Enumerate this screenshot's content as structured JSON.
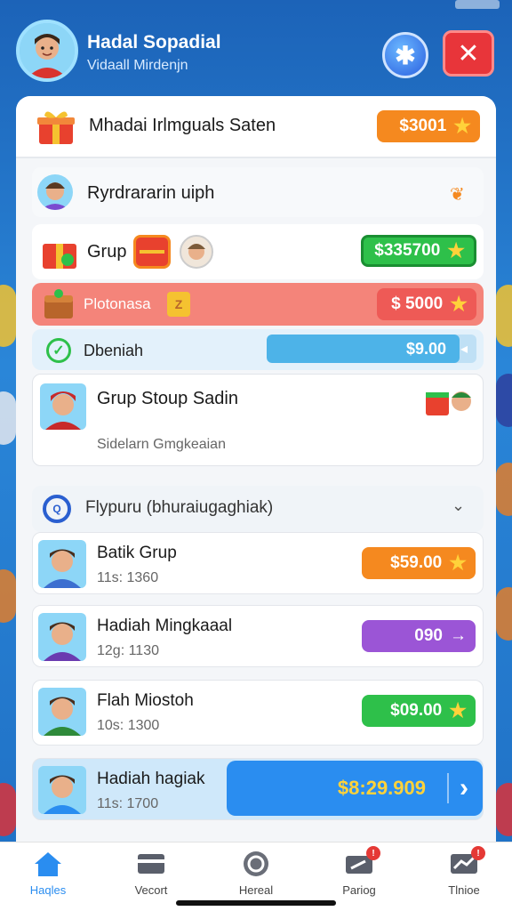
{
  "header": {
    "title": "Hadal Sopadial",
    "subtitle": "Vidaall Mirdenjn"
  },
  "rows": {
    "top_reward": {
      "label": "Mhadai Irlmguals Saten",
      "value": "$3001"
    },
    "section_a": {
      "label": "Ryrdrararin uiph"
    },
    "grup": {
      "label": "Grup",
      "value": "$335700"
    },
    "promo": {
      "label": "Plotonasa",
      "value": "$ 5000"
    },
    "progress": {
      "label": "Dbeniah",
      "value": "$9.00",
      "progress": 0.92
    },
    "group_card": {
      "title": "Grup Stoup Sadin",
      "subtitle": "Sidelarn Gmgkeaian"
    },
    "section_b": {
      "label": "Flypuru (bhuraiugaghiak)"
    }
  },
  "list": [
    {
      "name": "Batik Grup",
      "sub": "11s: 1360",
      "value": "$59.00",
      "color": "#f5891f",
      "icon": "star"
    },
    {
      "name": "Hadiah Mingkaaal",
      "sub": "12g: 1130",
      "value": "090",
      "color": "#9b55d6",
      "icon": "arrow"
    },
    {
      "name": "Flah Miostoh",
      "sub": "10s: 1300",
      "value": "$09.00",
      "color": "#2ec04a",
      "icon": "star"
    },
    {
      "name": "Hadiah hagiak",
      "sub": "11s: 1700",
      "value": "$8:29.909",
      "color": "#2a8df0",
      "icon": "chevron"
    }
  ],
  "nav": [
    {
      "label": "Haqles",
      "icon": "home-icon",
      "active": true
    },
    {
      "label": "Vecort",
      "icon": "card-icon"
    },
    {
      "label": "Hereal",
      "icon": "circle-icon"
    },
    {
      "label": "Pariog",
      "icon": "send-icon",
      "badge": "!"
    },
    {
      "label": "Tlnioe",
      "icon": "chart-icon",
      "badge": "!"
    }
  ],
  "colors": {
    "accent": "#2a8df0",
    "orange": "#f5891f",
    "green": "#2ec04a",
    "purple": "#9b55d6",
    "red": "#e8353a"
  }
}
